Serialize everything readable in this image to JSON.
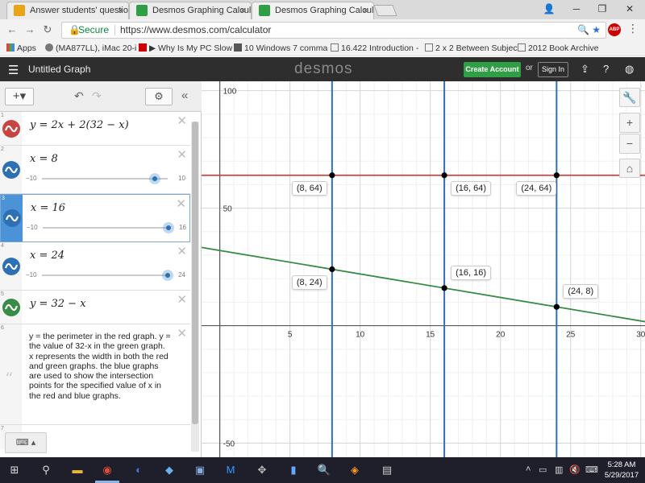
{
  "browser": {
    "tabs": [
      {
        "title": "Answer students' questio",
        "favicon_color": "#e8a317"
      },
      {
        "title": "Desmos Graphing Calcul",
        "favicon_color": "#2f9e44"
      },
      {
        "title": "Desmos Graphing Calcul",
        "favicon_color": "#2f9e44"
      }
    ],
    "secure_label": "Secure",
    "url": "https://www.desmos.com/calculator",
    "bookmarks": [
      "Apps",
      "(MA877LL), iMac 20-i",
      "▶ Why Is My PC Slow",
      "10 Windows 7 comma",
      "16.422 Introduction -",
      "2 x 2 Between Subjec",
      "2012 Book Archive"
    ]
  },
  "header": {
    "graph_title": "Untitled Graph",
    "logo": "desmos",
    "create_account": "Create Account",
    "or": "or",
    "sign_in": "Sign In"
  },
  "expressions": [
    {
      "index": "1",
      "latex": "y = 2x + 2(32 − x)",
      "color": "#c74440"
    },
    {
      "index": "2",
      "latex": "x = 8",
      "color": "#2d70b3",
      "slider": {
        "min": "−10",
        "max": "10",
        "value": 8,
        "range": [
          -10,
          10
        ]
      }
    },
    {
      "index": "3",
      "latex": "x = 16",
      "color": "#2d70b3",
      "slider": {
        "min": "−10",
        "max": "16",
        "value": 16,
        "range": [
          -10,
          16
        ]
      }
    },
    {
      "index": "4",
      "latex": "x = 24",
      "color": "#2d70b3",
      "slider": {
        "min": "−10",
        "max": "24",
        "value": 24,
        "range": [
          -10,
          24
        ]
      }
    },
    {
      "index": "5",
      "latex": "y = 32 − x",
      "color": "#388c46"
    },
    {
      "index": "6",
      "note": "y = the perimeter in the red graph.  y = the value of 32-x in the green graph.  x represents the width in both the red and green graphs.  the blue graphs are used to show the intersection points for the specified value of x in the red and blue graphs."
    },
    {
      "index": "7"
    }
  ],
  "graph": {
    "x_ticks": [
      "5",
      "10",
      "15",
      "20",
      "25",
      "30"
    ],
    "y_ticks": [
      "100",
      "50",
      "-50"
    ],
    "point_labels": [
      "(8, 64)",
      "(16, 64)",
      "(24, 64)",
      "(8, 24)",
      "(16, 16)",
      "(24, 8)"
    ]
  },
  "chart_data": {
    "type": "line",
    "xlim": [
      -1.3,
      30.3
    ],
    "ylim": [
      -56,
      104
    ],
    "grid": true,
    "series": [
      {
        "color": "#c74440",
        "kind": "line",
        "slope": 0,
        "intercept": 64
      },
      {
        "color": "#388c46",
        "kind": "line",
        "slope": -1,
        "intercept": 32
      },
      {
        "color": "#2d70b3",
        "kind": "vline",
        "x": 8
      },
      {
        "color": "#2d70b3",
        "kind": "vline",
        "x": 16
      },
      {
        "color": "#2d70b3",
        "kind": "vline",
        "x": 24
      }
    ],
    "points": [
      {
        "x": 8,
        "y": 64,
        "label": "(8, 64)",
        "label_pos": "below-left"
      },
      {
        "x": 16,
        "y": 64,
        "label": "(16, 64)",
        "label_pos": "below-right"
      },
      {
        "x": 24,
        "y": 64,
        "label": "(24, 64)",
        "label_pos": "below-left"
      },
      {
        "x": 8,
        "y": 24,
        "label": "(8, 24)",
        "label_pos": "below-left"
      },
      {
        "x": 16,
        "y": 16,
        "label": "(16, 16)",
        "label_pos": "above-right"
      },
      {
        "x": 24,
        "y": 8,
        "label": "(24, 8)",
        "label_pos": "above-right"
      }
    ]
  },
  "taskbar": {
    "time": "5:28 AM",
    "date": "5/29/2017"
  }
}
